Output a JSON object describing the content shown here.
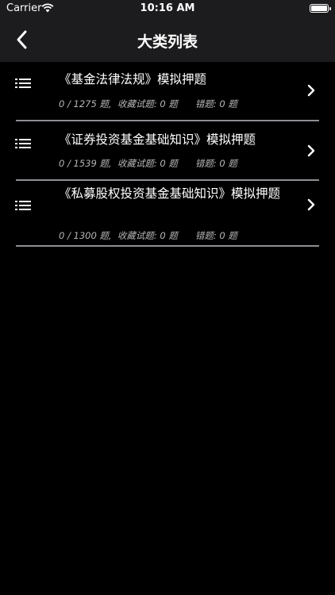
{
  "status": {
    "carrier": "Carrier",
    "time": "10:16 AM"
  },
  "nav": {
    "title": "大类列表"
  },
  "items": [
    {
      "title": "《基金法律法规》模拟押题",
      "meta": "0 / 1275 题,  收藏试题: 0 题      错题: 0 题"
    },
    {
      "title": "《证券投资基金基础知识》模拟押题",
      "meta": "0 / 1539 题,  收藏试题: 0 题      错题: 0 题"
    },
    {
      "title": "《私募股权投资基金基础知识》模拟押题",
      "meta": "0 / 1300 题,  收藏试题: 0 题      错题: 0 题"
    }
  ],
  "icons": {
    "back": "chevron-left-icon",
    "row": "list-icon",
    "disclosure": "chevron-right-icon"
  },
  "colors": {
    "bar": "#1c1c1e",
    "background": "#000000",
    "divider": "#8e8e93"
  }
}
